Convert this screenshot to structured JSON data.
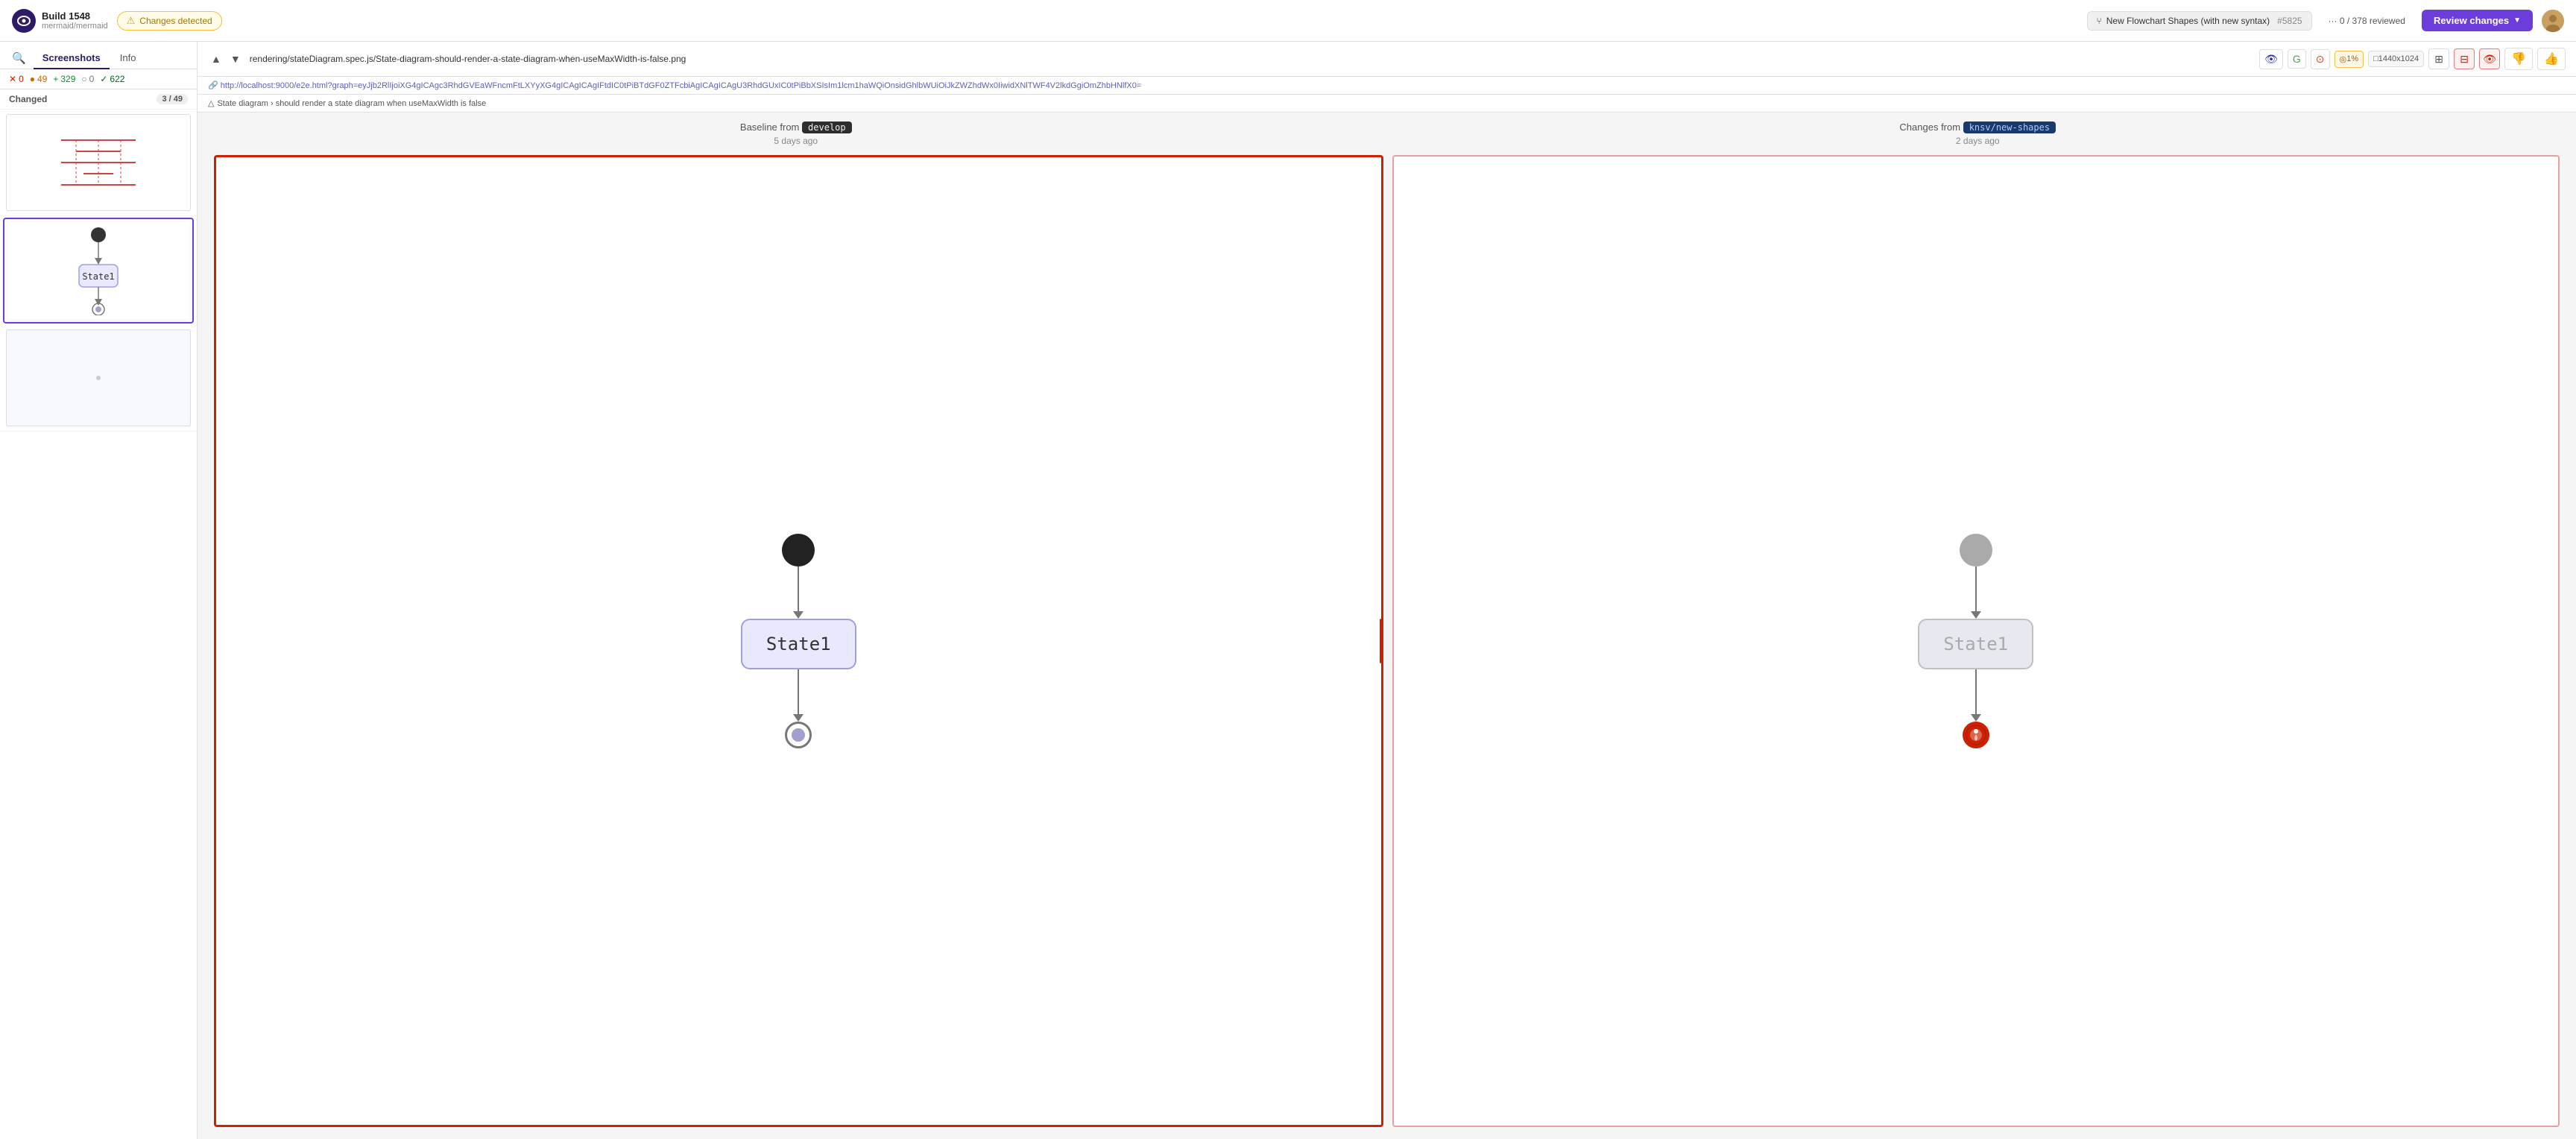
{
  "app": {
    "logo_text": "●",
    "build_title": "Build 1548",
    "build_repo": "mermaid/mermaid"
  },
  "header": {
    "changes_badge": "Changes detected",
    "pr_title": "New Flowchart Shapes (with new syntax)",
    "pr_number": "#5825",
    "review_progress": "··· 0 / 378 reviewed",
    "review_btn": "Review changes"
  },
  "sidebar": {
    "tabs": [
      {
        "id": "screenshots",
        "label": "Screenshots",
        "active": true
      },
      {
        "id": "info",
        "label": "Info",
        "active": false
      }
    ],
    "stats": [
      {
        "type": "removed",
        "count": "0",
        "icon": "✕"
      },
      {
        "type": "changed",
        "count": "49",
        "icon": "!"
      },
      {
        "type": "added",
        "count": "329",
        "icon": "+"
      },
      {
        "type": "unchanged",
        "count": "0",
        "icon": "="
      },
      {
        "type": "total",
        "count": "622",
        "icon": "✓"
      }
    ],
    "section": {
      "label": "Changed",
      "count": "3 / 49"
    }
  },
  "file": {
    "path": "rendering/stateDiagram.spec.js/State-diagram-should-render-a-state-diagram-when-useMaxWidth-is-false.png",
    "dimensions": "1440x1024",
    "diff_percent": "1%",
    "url": "http://localhost:9000/e2e.html?graph=eyJjb2RlIjoiXG4gICAgc3RhdGVEaWFncmFtLXYyXG4gICAgICAgIFtdIC0tPiBTdGF0ZTFcbiAgICAgICAgU3RhdGUxIC0tPiBbXSIsIm1lcm1haWQiOnsidGhlbWUiOiJkZWZhdWx0IiwidXNlTWF4V2lkdGgiOmZhbHNlfX0=",
    "breadcrumb": "State diagram › should render a state diagram when useMaxWidth is false"
  },
  "comparison": {
    "baseline": {
      "label": "Baseline from",
      "branch": "develop",
      "time": "5 days ago"
    },
    "changes": {
      "label": "Changes from",
      "branch": "knsv/new-shapes",
      "time": "2 days ago"
    }
  },
  "diagrams": {
    "baseline": {
      "start_label": "●",
      "state_label": "State1",
      "end_type": "circle"
    },
    "changed": {
      "start_label": "●",
      "state_label": "State1",
      "end_type": "red_circle"
    }
  }
}
